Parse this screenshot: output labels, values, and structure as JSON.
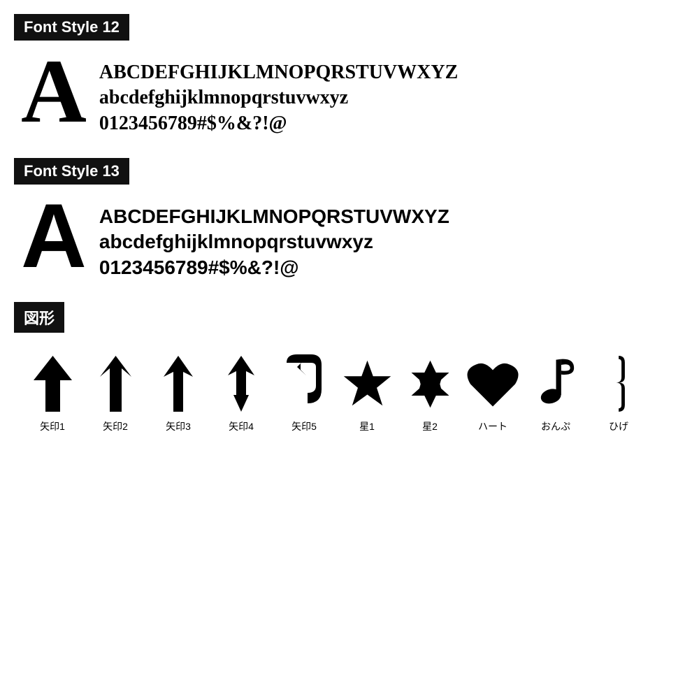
{
  "font12": {
    "header": "Font Style 12",
    "big_letter": "A",
    "uppercase": "BCDEFGHIJKLMNOPQRSTUVWXYZ",
    "lowercase": "abcdefghijklmnopqrstuvwxyz",
    "numbers": "0123456789#$%&?!@"
  },
  "font13": {
    "header": "Font Style 13",
    "big_letter": "A",
    "uppercase": "BCDEFGHIJKLMNOPQRSTUVWXYZ",
    "lowercase": "abcdefghijklmnopqrstuvwxyz",
    "numbers": "0123456789#$%&?!@"
  },
  "shapes": {
    "header": "図形",
    "items": [
      {
        "label": "矢印1"
      },
      {
        "label": "矢印2"
      },
      {
        "label": "矢印3"
      },
      {
        "label": "矢印4"
      },
      {
        "label": "矢印5"
      },
      {
        "label": "星1"
      },
      {
        "label": "星2"
      },
      {
        "label": "ハート"
      },
      {
        "label": "おんぷ"
      },
      {
        "label": "ひげ"
      }
    ]
  }
}
